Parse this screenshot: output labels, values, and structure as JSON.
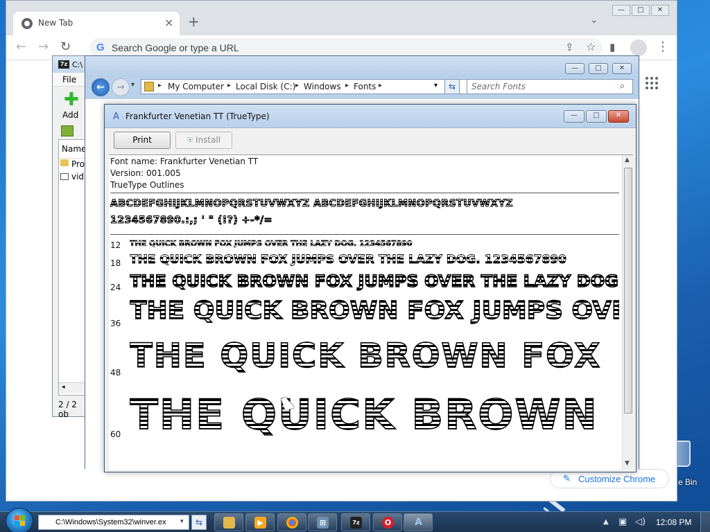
{
  "chrome": {
    "tab_title": "New Tab",
    "omnibox_placeholder": "Search Google or type a URL",
    "customize_label": "Customize Chrome"
  },
  "zip": {
    "title": "C:\\",
    "menu_file": "File",
    "add_label": "Add",
    "column_name": "Name",
    "rows": [
      "Pro",
      "vid"
    ],
    "status": "2 / 2 ob"
  },
  "explorer": {
    "breadcrumbs": [
      "My Computer",
      "Local Disk (C:)",
      "Windows",
      "Fonts"
    ],
    "search_placeholder": "Search Fonts"
  },
  "font_viewer": {
    "title": "Frankfurter Venetian TT (TrueType)",
    "print_label": "Print",
    "install_label": "Install",
    "font_name_line": "Font name: Frankfurter Venetian TT",
    "version_line": "Version: 001.005",
    "outline_line": "TrueType Outlines",
    "alphabet_line": "ABCDEFGHIJKLMNOPQRSTUVWXYZ ABCDEFGHIJKLMNOPQRSTUVWXYZ",
    "digits_line": "1234567890.:,; ' \" (!?) +-*/=",
    "samples": [
      {
        "size": "12",
        "text": "THE QUICK BROWN FOX JUMPS OVER THE LAZY DOG. 1234567890"
      },
      {
        "size": "18",
        "text": "THE QUICK BROWN FOX JUMPS OVER THE LAZY DOG. 1234567890"
      },
      {
        "size": "24",
        "text": "THE QUICK BROWN FOX JUMPS OVER THE LAZY DOG."
      },
      {
        "size": "36",
        "text": "THE QUICK BROWN FOX JUMPS OVER"
      },
      {
        "size": "48",
        "text": "THE QUICK BROWN FOX"
      },
      {
        "size": "60",
        "text": "THE QUICK BROWN"
      }
    ]
  },
  "taskbar": {
    "run_value": "C:\\Windows\\System32\\winver.ex",
    "clock": "12:08 PM"
  },
  "desktop": {
    "recycle_label": "e Bin"
  }
}
